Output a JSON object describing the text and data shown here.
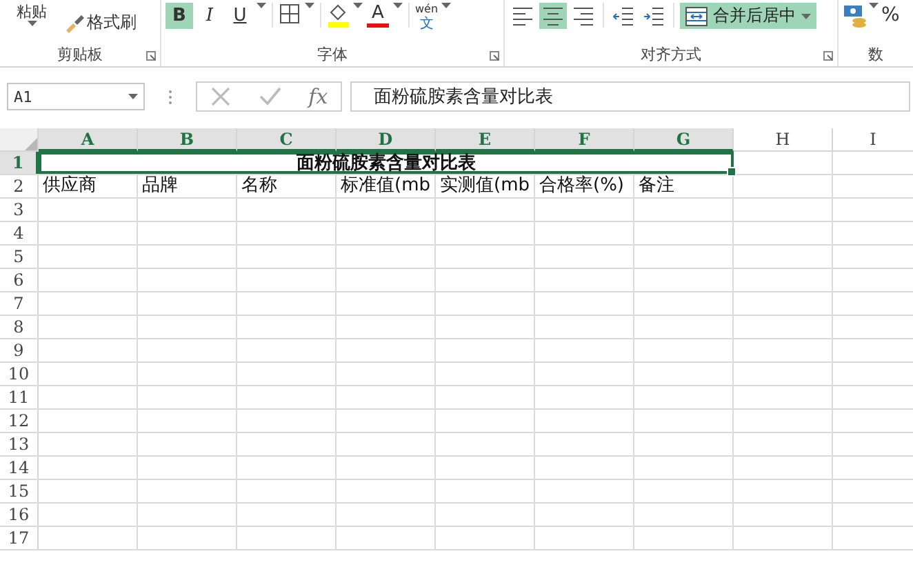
{
  "ribbon": {
    "groups": [
      {
        "label": "剪贴板",
        "launcher": true,
        "items": [
          {
            "kind": "paste",
            "label": "粘贴"
          },
          {
            "kind": "painter",
            "label": "格式刷"
          }
        ]
      },
      {
        "label": "字体",
        "launcher": true,
        "items": [
          {
            "kind": "bold",
            "label": "B",
            "selected": true
          },
          {
            "kind": "italic",
            "label": "I",
            "selected": false
          },
          {
            "kind": "underline",
            "label": "U",
            "selected": false
          },
          {
            "kind": "caret"
          },
          {
            "kind": "sep"
          },
          {
            "kind": "borders"
          },
          {
            "kind": "caret"
          },
          {
            "kind": "sep"
          },
          {
            "kind": "fill"
          },
          {
            "kind": "caret"
          },
          {
            "kind": "fontcolor",
            "label": "A"
          },
          {
            "kind": "caret"
          },
          {
            "kind": "sep"
          },
          {
            "kind": "phonetic",
            "label": "wén",
            "sub": "文"
          },
          {
            "kind": "caret"
          }
        ]
      },
      {
        "label": "对齐方式",
        "launcher": true,
        "items": [
          {
            "kind": "align-left",
            "selected": false
          },
          {
            "kind": "align-center",
            "selected": true
          },
          {
            "kind": "align-right",
            "selected": false
          },
          {
            "kind": "sep"
          },
          {
            "kind": "indent-decrease",
            "selected": false
          },
          {
            "kind": "indent-increase",
            "selected": false
          },
          {
            "kind": "sep"
          },
          {
            "kind": "merge",
            "label": "合并后居中",
            "selected": true
          }
        ]
      },
      {
        "label": "数",
        "items": [
          {
            "kind": "currency"
          },
          {
            "kind": "caret"
          },
          {
            "kind": "percent",
            "label": "%"
          }
        ]
      }
    ]
  },
  "name_box": {
    "value": "A1"
  },
  "formula_bar": {
    "function_label": "fx",
    "value": "面粉硫胺素含量对比表"
  },
  "sheet": {
    "columns": [
      {
        "label": "A",
        "selected": true
      },
      {
        "label": "B",
        "selected": true
      },
      {
        "label": "C",
        "selected": true
      },
      {
        "label": "D",
        "selected": true
      },
      {
        "label": "E",
        "selected": true
      },
      {
        "label": "F",
        "selected": true
      },
      {
        "label": "G",
        "selected": true
      },
      {
        "label": "H",
        "selected": false
      },
      {
        "label": "I",
        "selected": false
      }
    ],
    "rows": [
      {
        "label": "1",
        "selected": true,
        "kind": "title",
        "title": "面粉硫胺素含量对比表"
      },
      {
        "label": "2",
        "selected": false,
        "kind": "cells",
        "cells": [
          "供应商",
          "品牌",
          "名称",
          "标准值(mb",
          "实测值(mb",
          "合格率(%)",
          "备注"
        ]
      },
      {
        "label": "3",
        "selected": false,
        "kind": "empty"
      },
      {
        "label": "4",
        "selected": false,
        "kind": "empty"
      },
      {
        "label": "5",
        "selected": false,
        "kind": "empty"
      },
      {
        "label": "6",
        "selected": false,
        "kind": "empty"
      },
      {
        "label": "7",
        "selected": false,
        "kind": "empty"
      },
      {
        "label": "8",
        "selected": false,
        "kind": "empty"
      },
      {
        "label": "9",
        "selected": false,
        "kind": "empty"
      },
      {
        "label": "10",
        "selected": false,
        "kind": "empty"
      },
      {
        "label": "11",
        "selected": false,
        "kind": "empty"
      },
      {
        "label": "12",
        "selected": false,
        "kind": "empty"
      },
      {
        "label": "13",
        "selected": false,
        "kind": "empty"
      },
      {
        "label": "14",
        "selected": false,
        "kind": "empty"
      },
      {
        "label": "15",
        "selected": false,
        "kind": "empty"
      },
      {
        "label": "16",
        "selected": false,
        "kind": "empty"
      },
      {
        "label": "17",
        "selected": false,
        "kind": "empty"
      }
    ]
  }
}
